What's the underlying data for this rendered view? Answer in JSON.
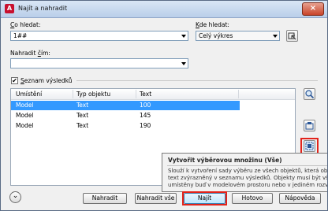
{
  "window": {
    "title": "Najít a nahradit",
    "app_icon_letter": "A",
    "close_glyph": "×"
  },
  "find": {
    "label_prefix": "C",
    "label_rest": "o hledat:",
    "value": "1##"
  },
  "where": {
    "label_prefix": "K",
    "label_rest": "de hledat:",
    "value": "Celý výkres"
  },
  "replace": {
    "label_prefix": "Nahradit ",
    "label_u": "č",
    "label_rest": "ím:",
    "value": ""
  },
  "results_toggle": {
    "check_glyph": "✔",
    "label_prefix": "S",
    "label_rest": "eznam výsledků",
    "checked": true
  },
  "table": {
    "headers": [
      "Umístění",
      "Typ objektu",
      "Text"
    ],
    "rows": [
      {
        "location": "Model",
        "type": "Text",
        "text": "100",
        "selected": true
      },
      {
        "location": "Model",
        "type": "Text",
        "text": "145",
        "selected": false
      },
      {
        "location": "Model",
        "type": "Text",
        "text": "190",
        "selected": false
      }
    ]
  },
  "tooltip": {
    "title": "Vytvořit výběrovou množinu (Vše)",
    "lines": [
      "Slouží k vytvoření sady výběru ze všech objektů, která obsah",
      "text zvýrazněný v seznamu výsledků. Objekty musí být všec",
      "umístěny buď v modelovém prostoru nebo v jediném rozv"
    ]
  },
  "buttons": {
    "expand_glyph": "⌄",
    "replace": "Nahradit",
    "replace_all": "Nahradit vše",
    "find": "Najít",
    "done": "Hotovo",
    "help": "Nápověda"
  },
  "colors": {
    "selection": "#3399ff",
    "highlight": "#e2231a"
  }
}
